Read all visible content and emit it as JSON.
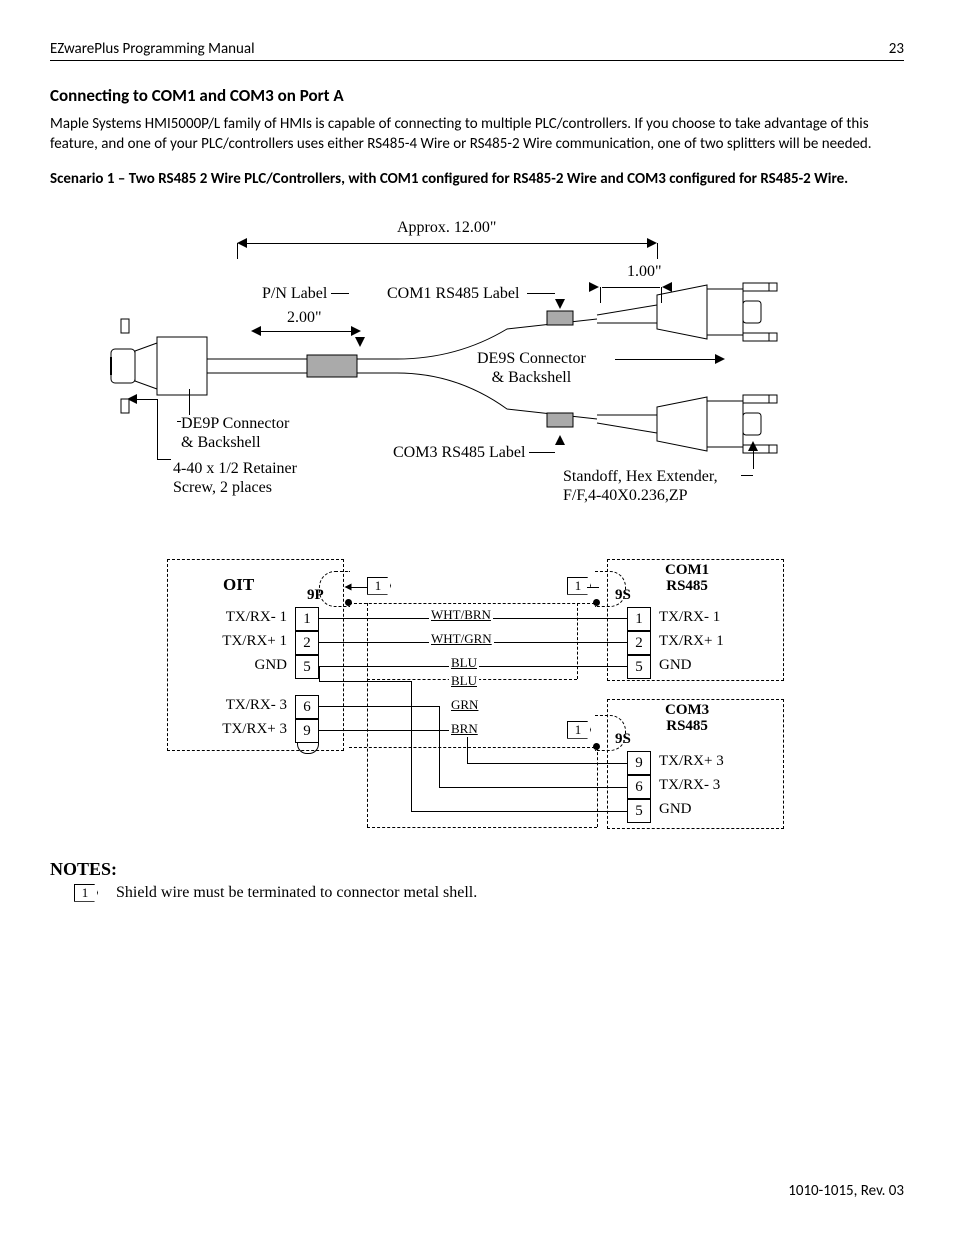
{
  "header": {
    "title": "EZwarePlus Programming Manual",
    "page": "23"
  },
  "section_title": "Connecting to COM1 and COM3 on Port A",
  "intro": "Maple Systems HMI5000P/L family of HMIs is capable of connecting to multiple PLC/controllers. If you choose to take advantage of this feature, and one of your PLC/controllers uses either RS485-4 Wire or RS485-2 Wire communication, one of two splitters will be needed.",
  "scenario": "Scenario 1 – Two RS485 2 Wire PLC/Controllers, with COM1 configured for RS485-2 Wire and COM3 configured for RS485-2 Wire.",
  "cable": {
    "dim_overall": "Approx. 12.00\"",
    "dim_branch": "1.00\"",
    "dim_label": "2.00\"",
    "pn_label": "P/N Label",
    "com1_label": "COM1 RS485 Label",
    "com3_label": "COM3 RS485 Label",
    "de9s": "DE9S Connector\n& Backshell",
    "de9p": "DE9P Connector\n& Backshell",
    "retainer": "4-40 x 1/2 Retainer\nScrew, 2 places",
    "standoff": "Standoff, Hex Extender,\nF/F,4-40X0.236,ZP"
  },
  "wiring": {
    "oit_title": "OIT",
    "com1_title": "COM1\nRS485",
    "com3_title": "COM3\nRS485",
    "p9": "9P",
    "s9": "9S",
    "oit_rows": [
      {
        "sig": "TX/RX-  1",
        "pin": "1"
      },
      {
        "sig": "TX/RX+ 1",
        "pin": "2"
      },
      {
        "sig": "GND",
        "pin": "5"
      },
      {
        "sig": "TX/RX-  3",
        "pin": "6"
      },
      {
        "sig": "TX/RX+ 3",
        "pin": "9"
      }
    ],
    "com1_rows": [
      {
        "pin": "1",
        "sig": "TX/RX-  1"
      },
      {
        "pin": "2",
        "sig": "TX/RX+ 1"
      },
      {
        "pin": "5",
        "sig": "GND"
      }
    ],
    "com3_rows": [
      {
        "pin": "9",
        "sig": "TX/RX+ 3"
      },
      {
        "pin": "6",
        "sig": "TX/RX-  3"
      },
      {
        "pin": "5",
        "sig": "GND"
      }
    ],
    "wire_colors": [
      "WHT/BRN",
      "WHT/GRN",
      "BLU",
      "BLU",
      "GRN",
      "BRN"
    ],
    "note_flag": "1"
  },
  "notes": {
    "heading": "NOTES:",
    "items": [
      {
        "n": "1",
        "text": "Shield wire must be terminated to connector metal shell."
      }
    ]
  },
  "footer": "1010-1015, Rev. 03"
}
